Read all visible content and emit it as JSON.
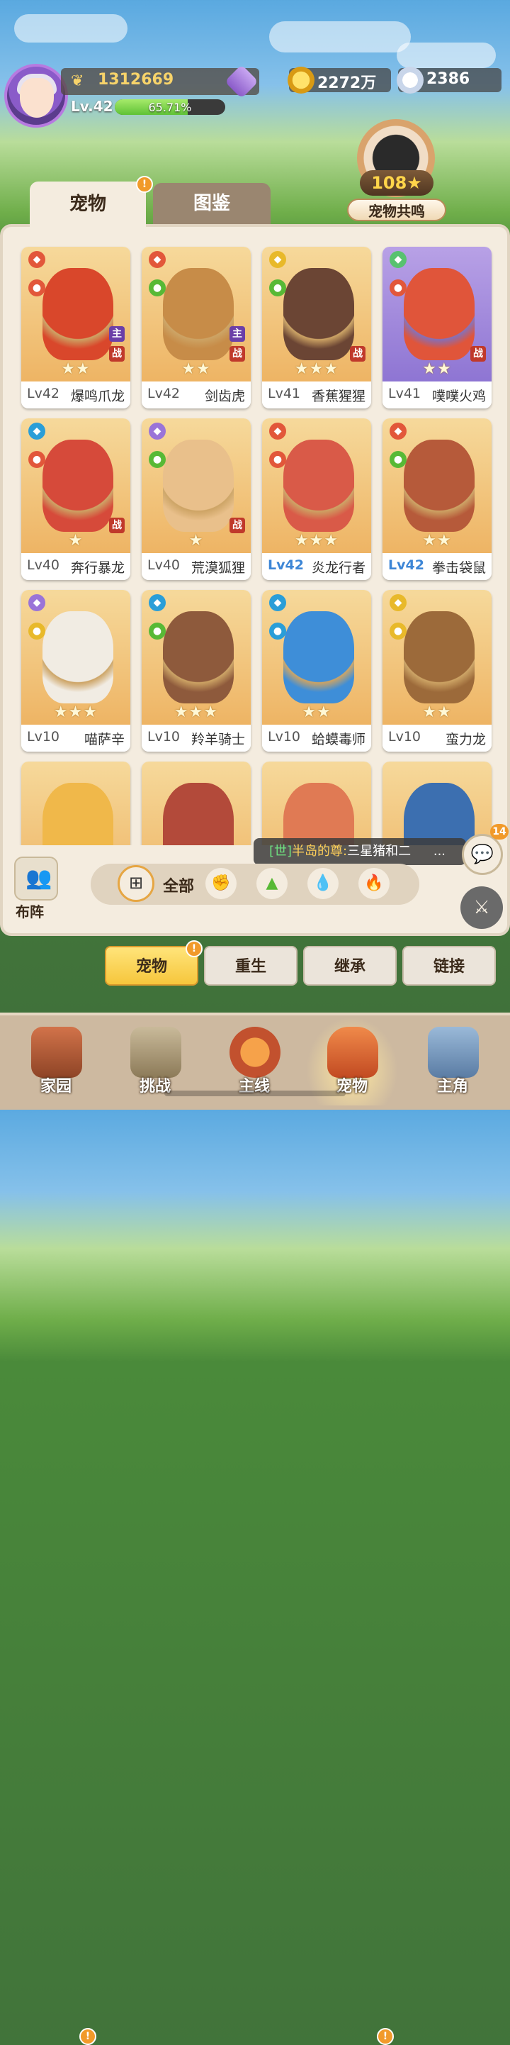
{
  "player": {
    "power": "1312669",
    "level_label": "Lv.42",
    "xp_percent": "65.71%",
    "xp_fraction": 0.6571
  },
  "resources": {
    "gold": "2272万",
    "shells": "2386"
  },
  "resonance": {
    "value": "108",
    "label": "宠物共鸣"
  },
  "tabs": {
    "pets": "宠物",
    "codex": "图鉴"
  },
  "pets": [
    {
      "level": "Lv42",
      "name": "爆鸣爪龙",
      "stars": 2,
      "badge_main": "主",
      "badge_war": "战"
    },
    {
      "level": "Lv42",
      "name": "剑齿虎",
      "stars": 2,
      "badge_main": "主",
      "badge_war": "战"
    },
    {
      "level": "Lv41",
      "name": "香蕉猩猩",
      "stars": 3,
      "badge_war": "战"
    },
    {
      "level": "Lv41",
      "name": "噗噗火鸡",
      "stars": 2,
      "badge_war": "战"
    },
    {
      "level": "Lv40",
      "name": "奔行暴龙",
      "stars": 1,
      "badge_war": "战"
    },
    {
      "level": "Lv40",
      "name": "荒漠狐狸",
      "stars": 1,
      "badge_war": "战"
    },
    {
      "level": "Lv42",
      "name": "炎龙行者",
      "stars": 3
    },
    {
      "level": "Lv42",
      "name": "拳击袋鼠",
      "stars": 2
    },
    {
      "level": "Lv10",
      "name": "喵萨辛",
      "stars": 3
    },
    {
      "level": "Lv10",
      "name": "羚羊骑士",
      "stars": 3
    },
    {
      "level": "Lv10",
      "name": "蛤蟆毒师",
      "stars": 2
    },
    {
      "level": "Lv10",
      "name": "蛮力龙",
      "stars": 2
    }
  ],
  "chat": {
    "channel": "[世]",
    "user": "半岛的尊:",
    "message": "三星猪和二",
    "ellipsis": "...",
    "unread": "14"
  },
  "filters": {
    "formation_label": "布阵",
    "all_label": "全部"
  },
  "subtabs": {
    "pets": "宠物",
    "rebirth": "重生",
    "inherit": "继承",
    "link": "链接"
  },
  "nav": {
    "home": "家园",
    "challenge": "挑战",
    "main": "主线",
    "pets": "宠物",
    "hero": "主角"
  },
  "alerts": {
    "exclaim": "!"
  }
}
